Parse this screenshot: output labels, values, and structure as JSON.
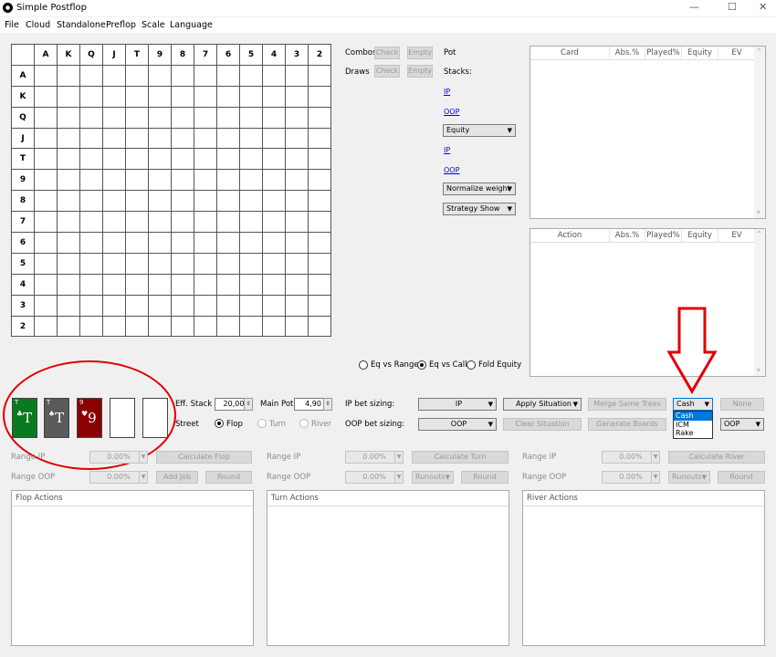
{
  "window": {
    "title": "Simple Postflop",
    "minimize": "—",
    "maximize": "☐",
    "close": "✕"
  },
  "menu": [
    "File",
    "Cloud",
    "Standalone",
    "Preflop",
    "Scale",
    "Language"
  ],
  "grid": {
    "cols": [
      "A",
      "K",
      "Q",
      "J",
      "T",
      "9",
      "8",
      "7",
      "6",
      "5",
      "4",
      "3",
      "2"
    ],
    "rows": [
      "A",
      "K",
      "Q",
      "J",
      "T",
      "9",
      "8",
      "7",
      "6",
      "5",
      "4",
      "3",
      "2"
    ]
  },
  "combos": {
    "label": "Combos",
    "check": "Check",
    "empty": "Empty"
  },
  "draws": {
    "label": "Draws",
    "check": "Check",
    "empty": "Empty"
  },
  "pot": {
    "label": "Pot",
    "stacks": "Stacks:",
    "ip": "IP",
    "oop": "OOP",
    "ip2": "IP",
    "oop2": "OOP"
  },
  "selects": {
    "equity": "Equity",
    "normalize": "Normalize weight",
    "strategy": "Strategy Show"
  },
  "card_table": {
    "cols": [
      "Card",
      "Abs.%",
      "Played%",
      "Equity",
      "EV"
    ]
  },
  "action_table": {
    "cols": [
      "Action",
      "Abs.%",
      "Played%",
      "Equity",
      "EV"
    ]
  },
  "equity_mode": {
    "eq_vs_range": "Eq vs Range",
    "eq_vs_call": "Eq vs Call",
    "fold_equity": "Fold Equity"
  },
  "board_cards": [
    {
      "rank": "T",
      "suit": "♣",
      "color": "#0a7a1e"
    },
    {
      "rank": "T",
      "suit": "♠",
      "color": "#5a5a5a"
    },
    {
      "rank": "9",
      "suit": "♥",
      "color": "#8b0000"
    }
  ],
  "settings": {
    "eff_stack_label": "Eff. Stack",
    "eff_stack": "20,00",
    "main_pot_label": "Main Pot",
    "main_pot": "4,90",
    "street_label": "Street",
    "flop": "Flop",
    "turn": "Turn",
    "river": "River"
  },
  "sizing": {
    "ip_label": "IP bet sizing:",
    "oop_label": "OOP bet sizing:",
    "ip_value": "IP",
    "oop_value": "OOP",
    "apply": "Apply Situation",
    "clear": "Clear Situation",
    "merge": "Merge Same Trees",
    "generate": "Generate Boards",
    "none": "None",
    "oop_select": "OOP"
  },
  "game_type": {
    "selected": "Cash",
    "options": [
      "Cash",
      "ICM",
      "Rake"
    ]
  },
  "flop_calc": {
    "range_ip": "Range IP",
    "range_oop": "Range OOP",
    "ip_pct": "0.00%",
    "oop_pct": "0.00%",
    "calc": "Calculate Flop",
    "add_job": "Add Job",
    "round": "Round"
  },
  "turn_calc": {
    "range_ip": "Range IP",
    "range_oop": "Range OOP",
    "ip_pct": "0.00%",
    "oop_pct": "0.00%",
    "calc": "Calculate Turn",
    "runouts": "Runouts",
    "round": "Round"
  },
  "river_calc": {
    "range_ip": "Range IP",
    "range_oop": "Range OOP",
    "ip_pct": "0.00%",
    "oop_pct": "0.00%",
    "calc": "Calculate River",
    "runouts": "Runouts",
    "round": "Round"
  },
  "action_panels": {
    "flop": "Flop Actions",
    "turn": "Turn Actions",
    "river": "River Actions"
  },
  "annotation_color": "#e00000"
}
